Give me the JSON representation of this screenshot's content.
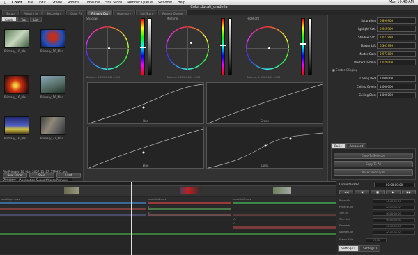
{
  "menubar": {
    "apple": "",
    "items": [
      "Color",
      "File",
      "Edit",
      "Grade",
      "Rooms",
      "Timeline",
      "Still Store",
      "Render Queue",
      "Window",
      "Help"
    ],
    "clock": "Mon 10:40 AM"
  },
  "window": {
    "title": "Color:ducati_grade.la"
  },
  "rooms": [
    "Setup",
    "Primary In",
    "Secondary",
    "Color FX",
    "Primary Out",
    "Geometry",
    "Still Store",
    "Render Queue"
  ],
  "active_room": 4,
  "left_panel": {
    "subtabs": [
      "Grade",
      "Tab",
      "List"
    ],
    "stills": [
      {
        "label": "Primary_10_Mar..."
      },
      {
        "label": "Primary_16_Mar..."
      },
      {
        "label": "Primary_16_Mar..."
      },
      {
        "label": "Primary_16_Mar..."
      },
      {
        "label": "Primary_16_Mar..."
      },
      {
        "label": "Primary_21_Mar..."
      }
    ],
    "file_label": "File",
    "file_value": "Primary_10_Mar_2007_11_27_57PM57.pcs",
    "dir_label": "Directory",
    "dir_value": "/Application Support/Color/Primary/",
    "buttons": [
      "New Folder",
      "Save",
      "Load"
    ]
  },
  "wheels": [
    {
      "title": "Shadow",
      "balance": "Balance: 0.000  0.000  0.000"
    },
    {
      "title": "Midtone",
      "balance": "Balance: 0.000  0.000  0.000"
    },
    {
      "title": "Highlight",
      "balance": "Balance: 0.000  0.000  0.000"
    }
  ],
  "curves": [
    "Red",
    "Green",
    "Blue",
    "Luma"
  ],
  "right_panel": {
    "params": [
      {
        "label": "Saturation",
        "value": "0.890908",
        "color": "yellow"
      },
      {
        "label": "Highlight Sat.",
        "value": "0.965909",
        "color": "yellow"
      },
      {
        "label": "Shadow Sat.",
        "value": "1.077998",
        "color": "yellow"
      },
      {
        "label": "Master Lift",
        "value": "0.301999",
        "color": "yellow"
      },
      {
        "label": "Master Gain",
        "value": "0.973000",
        "color": "yellow"
      },
      {
        "label": "Master Gamma",
        "value": "1.020000",
        "color": "yellow"
      }
    ],
    "enable_clipping": "Enable Clipping",
    "ceiling": [
      {
        "label": "Ceiling Red",
        "value": "1.000000"
      },
      {
        "label": "Ceiling Green",
        "value": "1.000000"
      },
      {
        "label": "Ceiling Blue",
        "value": "1.000000"
      }
    ],
    "tabs": [
      "Basic",
      "Advanced"
    ],
    "buttons": [
      "Copy To Selected",
      "Copy To All",
      "Reset Primary In"
    ]
  },
  "timeline": {
    "tracks": [
      "V1",
      "V2",
      "V3",
      "V4"
    ],
    "clip_labels": [
      "smallclip1.mov",
      "smallclip2.mov",
      "smallclip3.mov"
    ]
  },
  "timecode_panel": {
    "title": "Current Frame",
    "current": "00:00:00:00",
    "rows": [
      {
        "label": "Project In",
        "value": "00:00:00:00"
      },
      {
        "label": "Project Out",
        "value": "00:00:00:00"
      },
      {
        "label": "Trim In",
        "value": "00:00:00:00"
      },
      {
        "label": "Trim Out",
        "value": "00:00:00:00"
      },
      {
        "label": "Source In",
        "value": "00:00:00:00"
      },
      {
        "label": "Source Out",
        "value": "00:00:00:00"
      }
    ],
    "frame_rate_label": "Frame Rate",
    "frame_rate": "23.98",
    "bottom_tabs": [
      "Settings 1",
      "Settings 2"
    ]
  },
  "colors": {
    "accent": "#f0d040",
    "bg": "#2e2e2e",
    "panel": "#2a2a2a"
  }
}
